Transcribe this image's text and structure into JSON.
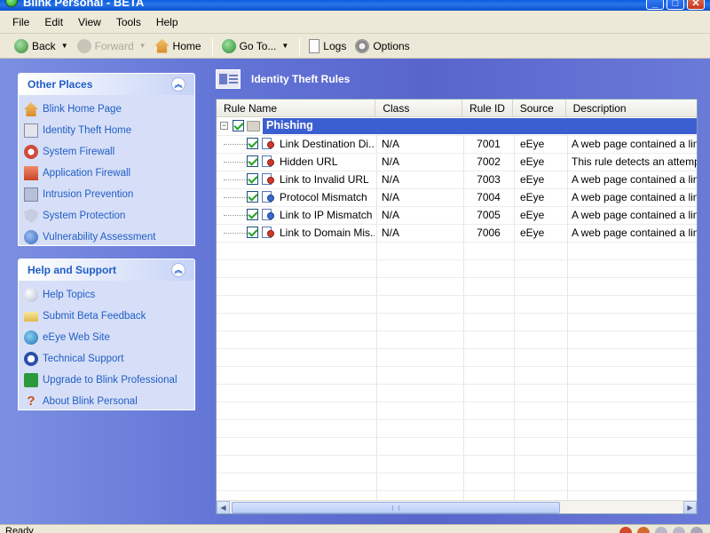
{
  "window": {
    "title": "Blink Personal - BETA",
    "controls": {
      "minimize": "_",
      "maximize": "□",
      "close": "✕"
    }
  },
  "menu": [
    "File",
    "Edit",
    "View",
    "Tools",
    "Help"
  ],
  "toolbar": {
    "back": "Back",
    "forward": "Forward",
    "home": "Home",
    "goto": "Go To...",
    "logs": "Logs",
    "options": "Options"
  },
  "sidebar": {
    "other_places": {
      "title": "Other Places",
      "items": [
        {
          "label": "Blink Home Page",
          "icon": "house-icon"
        },
        {
          "label": "Identity Theft Home",
          "icon": "id-card-icon"
        },
        {
          "label": "System Firewall",
          "icon": "firewall-icon"
        },
        {
          "label": "Application Firewall",
          "icon": "app-firewall-icon"
        },
        {
          "label": "Intrusion Prevention",
          "icon": "intrusion-icon"
        },
        {
          "label": "System Protection",
          "icon": "shield-icon"
        },
        {
          "label": "Vulnerability Assessment",
          "icon": "vulnerability-icon"
        }
      ]
    },
    "help_support": {
      "title": "Help and Support",
      "items": [
        {
          "label": "Help Topics",
          "icon": "help-topics-icon"
        },
        {
          "label": "Submit Beta Feedback",
          "icon": "envelope-icon"
        },
        {
          "label": "eEye Web Site",
          "icon": "globe-icon"
        },
        {
          "label": "Technical Support",
          "icon": "support-icon"
        },
        {
          "label": "Upgrade to Blink Professional",
          "icon": "arrow-right-icon"
        },
        {
          "label": "About Blink Personal",
          "icon": "question-icon"
        }
      ]
    }
  },
  "content": {
    "title": "Identity Theft Rules",
    "columns": [
      "Rule Name",
      "Class",
      "Rule ID",
      "Source",
      "Description"
    ],
    "group": "Phishing",
    "rows": [
      {
        "name": "Link Destination Di...",
        "class": "N/A",
        "id": "7001",
        "source": "eEye",
        "desc": "A web page contained a link t"
      },
      {
        "name": "Hidden URL",
        "class": "N/A",
        "id": "7002",
        "source": "eEye",
        "desc": "This rule detects an attempt to"
      },
      {
        "name": "Link to Invalid URL",
        "class": "N/A",
        "id": "7003",
        "source": "eEye",
        "desc": "A web page contained a link t"
      },
      {
        "name": "Protocol Mismatch",
        "class": "N/A",
        "id": "7004",
        "source": "eEye",
        "desc": "A web page contained a link t"
      },
      {
        "name": "Link to IP Mismatch",
        "class": "N/A",
        "id": "7005",
        "source": "eEye",
        "desc": "A web page contained a link t"
      },
      {
        "name": "Link to Domain Mis...",
        "class": "N/A",
        "id": "7006",
        "source": "eEye",
        "desc": "A web page contained a link t"
      }
    ]
  },
  "status": {
    "text": "Ready"
  },
  "colors": {
    "accent": "#215dc6",
    "group_bar": "#3b5fd0",
    "check": "#21a121"
  }
}
